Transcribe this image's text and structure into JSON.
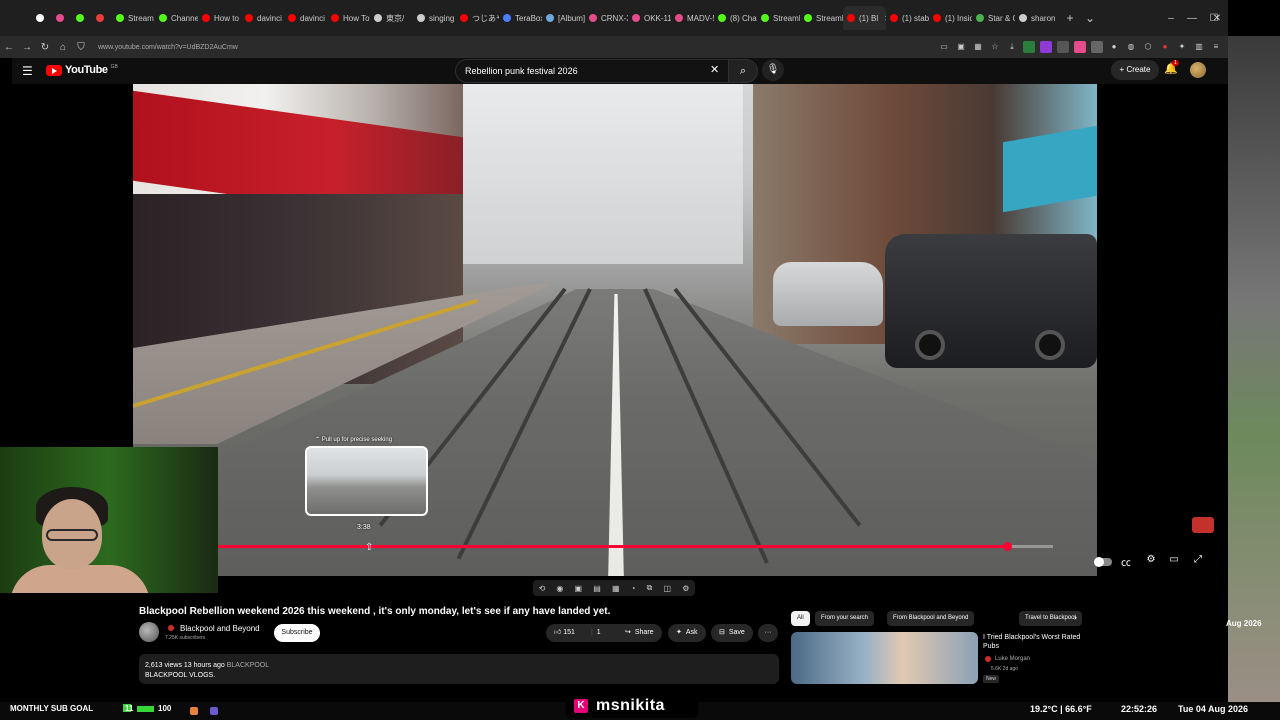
{
  "browser": {
    "tabs": [
      {
        "label": "",
        "color": "#ffffff"
      },
      {
        "label": "",
        "color": "#e44c8a"
      },
      {
        "label": "",
        "color": "#53fc18"
      },
      {
        "label": "",
        "color": "#e83e3e"
      },
      {
        "label": "Stream",
        "color": "#53fc18"
      },
      {
        "label": "Channel",
        "color": "#53fc18"
      },
      {
        "label": "How to",
        "color": "#ff0000"
      },
      {
        "label": "davinci",
        "color": "#ff0000"
      },
      {
        "label": "davinci",
        "color": "#ff0000"
      },
      {
        "label": "How To",
        "color": "#ff0000"
      },
      {
        "label": "東京/",
        "color": "#cccccc"
      },
      {
        "label": "singing",
        "color": "#cccccc"
      },
      {
        "label": "つじあや",
        "color": "#ff0000"
      },
      {
        "label": "TeraBox",
        "color": "#4a7dff"
      },
      {
        "label": "[Album]",
        "color": "#6fa8dc"
      },
      {
        "label": "CRNX-3",
        "color": "#e44c8a"
      },
      {
        "label": "OKK-11",
        "color": "#e44c8a"
      },
      {
        "label": "MADV-5",
        "color": "#e44c8a"
      },
      {
        "label": "(8) Chat",
        "color": "#53fc18"
      },
      {
        "label": "StreamE",
        "color": "#53fc18"
      },
      {
        "label": "StreamE",
        "color": "#53fc18"
      },
      {
        "label": "(1) Bl",
        "color": "#ff0000",
        "active": true
      },
      {
        "label": "(1) stabl",
        "color": "#ff0000"
      },
      {
        "label": "(1) Insid",
        "color": "#ff0000"
      },
      {
        "label": "Star & C",
        "color": "#4caf50"
      },
      {
        "label": "sharon g",
        "color": "#cccccc"
      }
    ],
    "url": "www.youtube.com/watch?v=UdBZD2AuCmw"
  },
  "youtube": {
    "logo": "YouTube",
    "logo_region": "GB",
    "search_query": "Rebellion punk festival 2026",
    "create_label": "Create",
    "notification_count": "1"
  },
  "player": {
    "seek_hint": "⌃ Pull up for precise seeking",
    "seek_time": "3:38",
    "progress_fraction": 0.945,
    "hover_fraction": 0.178,
    "progress_color": "#ff0033"
  },
  "video": {
    "title": "Blackpool Rebellion weekend 2026 this weekend , it's only monday, let's see if any have landed yet.",
    "channel_name": "Blackpool and Beyond",
    "channel_subs": "7.25K subscribers",
    "subscribe_label": "Subscribe",
    "like_count": "151",
    "dislike_count": "1",
    "share_label": "Share",
    "ask_label": "Ask",
    "save_label": "Save",
    "more_label": "···",
    "views_line": "2,613 views  13 hours ago",
    "location_tag": "BLACKPOOL",
    "desc_line": "BLACKPOOL VLOGS."
  },
  "recommendations": {
    "chips": [
      {
        "label": "All",
        "active": true
      },
      {
        "label": "From your search"
      },
      {
        "label": "From Blackpool and Beyond"
      },
      {
        "label": "Travel to Blackpool"
      }
    ],
    "first": {
      "title": "I Tried Blackpool's Worst Rated Pubs",
      "channel": "Luke Morgan",
      "meta": "5.6K  2d ago",
      "badge": "New"
    }
  },
  "side_window": {
    "date_fragment": "Aug 2026"
  },
  "overlay": {
    "sub_goal_label": "MONTHLY SUB GOAL",
    "sub_goal_current": "11",
    "sub_goal_max": "100",
    "sub_goal_fraction": 0.11,
    "streamer_name": "msnikita",
    "kick_letter": "K",
    "weather": "19.2°C | 66.6°F",
    "time": "22:52:26",
    "date": "Tue 04 Aug 2026",
    "accent_green": "#39d639",
    "kick_color": "#e5007a"
  }
}
